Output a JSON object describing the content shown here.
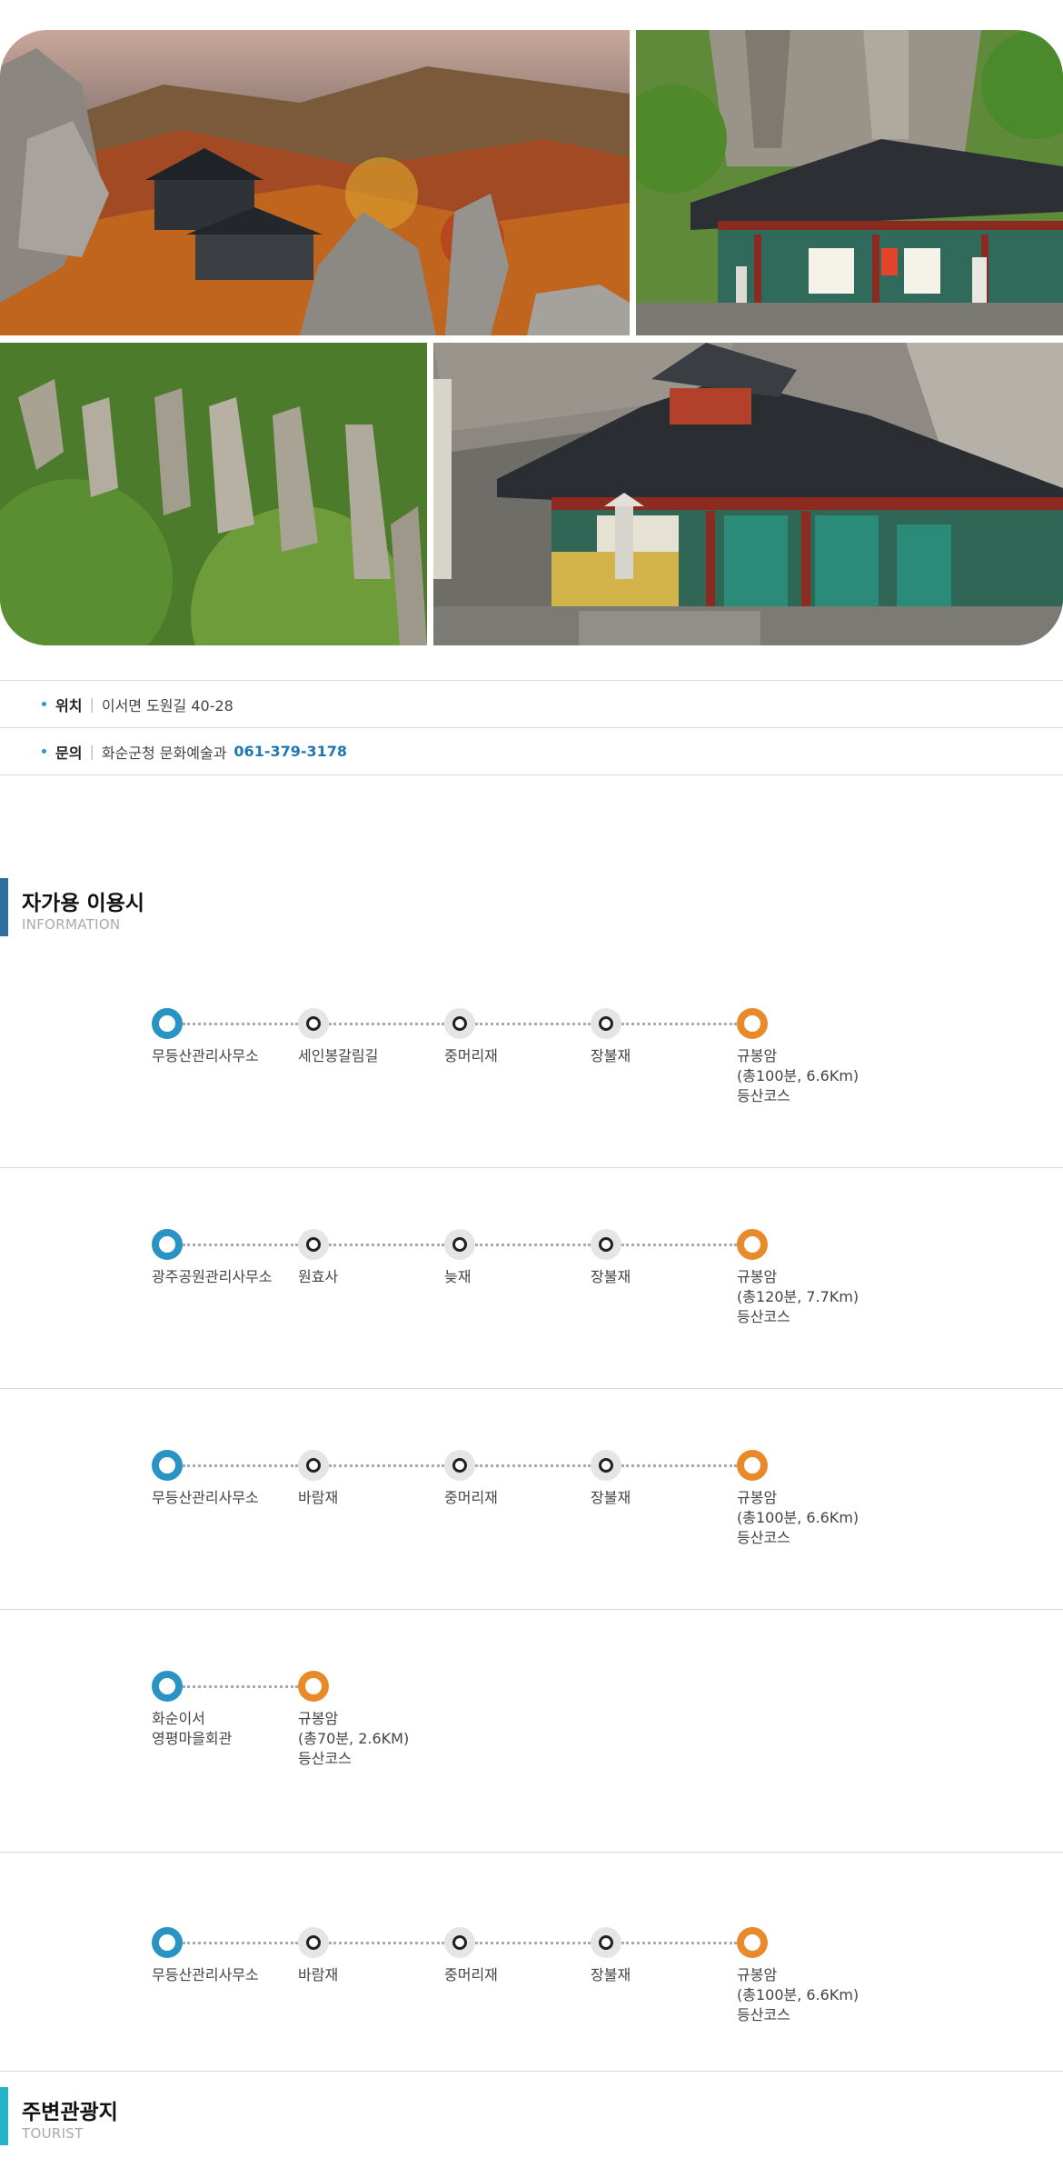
{
  "colors": {
    "start_node": "#2993c4",
    "end_node": "#e8892a",
    "accent_blue": "#1f78b4",
    "section_bar_1": "#2a6f9e",
    "section_bar_2": "#25b3c7"
  },
  "gallery": {
    "photos": [
      "autumn-mountain-temple-photo",
      "temple-hall-cliff-photo",
      "rocky-pillar-cliffs-photo",
      "temple-hall-lantern-photo"
    ]
  },
  "info": {
    "location": {
      "label": "위치",
      "value": "이서면 도원길 40-28"
    },
    "contact": {
      "label": "문의",
      "value": "화순군청 문화예술과",
      "phone": "061-379-3178"
    }
  },
  "sections": {
    "information": {
      "title": "자가용 이용시",
      "subtitle": "INFORMATION"
    },
    "tourist": {
      "title": "주변관광지",
      "subtitle": "TOURIST"
    }
  },
  "routes": [
    {
      "stops": [
        "무등산관리사무소",
        "세인봉갈림길",
        "중머리재",
        "장불재",
        "규봉암\n(총100분, 6.6Km)\n등산코스"
      ]
    },
    {
      "stops": [
        "광주공원관리사무소",
        "원효사",
        "늦재",
        "장불재",
        "규봉암\n(총120분, 7.7Km)\n등산코스"
      ]
    },
    {
      "stops": [
        "무등산관리사무소",
        "바람재",
        "중머리재",
        "장불재",
        "규봉암\n(총100분, 6.6Km)\n등산코스"
      ]
    },
    {
      "stops": [
        "화순이서\n영평마을회관",
        "규봉암\n(총70분, 2.6KM)\n등산코스"
      ]
    },
    {
      "stops": [
        "무등산관리사무소",
        "바람재",
        "중머리재",
        "장불재",
        "규봉암\n(총100분, 6.6Km)\n등산코스"
      ]
    }
  ]
}
